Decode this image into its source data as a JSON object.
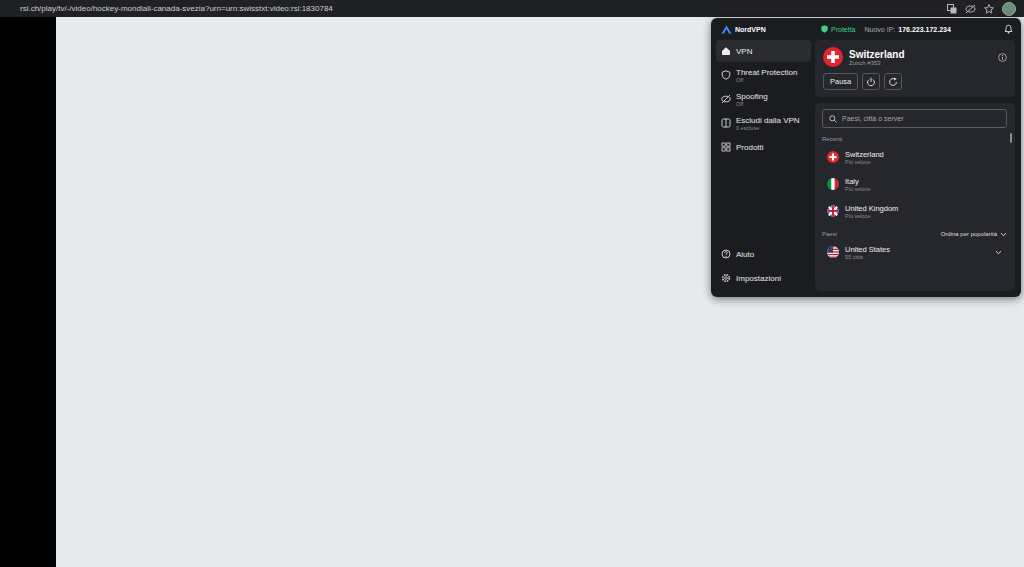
{
  "browser": {
    "url": "rsi.ch/play/tv/-/video/hockey-mondiali-canada-svezia?urn=urn:swisstxt:video:rsi:1830784"
  },
  "vpn": {
    "brand": "NordVPN",
    "status": "Protetta",
    "ip_label": "Nuovo IP:",
    "ip": "176.223.172.234",
    "nav": [
      {
        "label": "VPN",
        "sub": "",
        "kind": "home",
        "selected": true
      },
      {
        "label": "Threat Protection",
        "sub": "Off",
        "kind": "shield",
        "selected": false
      },
      {
        "label": "Spoofing",
        "sub": "Off",
        "kind": "spoof",
        "selected": false
      },
      {
        "label": "Escludi dalla VPN",
        "sub": "0 escluse",
        "kind": "split",
        "selected": false
      },
      {
        "label": "Prodotti",
        "sub": "",
        "kind": "grid",
        "selected": false
      }
    ],
    "footer_nav": [
      {
        "label": "Aiuto",
        "kind": "help"
      },
      {
        "label": "Impostazioni",
        "kind": "gear"
      }
    ],
    "current": {
      "country": "Switzerland",
      "server": "Zurich #353",
      "kind": "ch",
      "pause": "Pausa"
    },
    "search": {
      "placeholder": "Paesi, città o server"
    },
    "recent_title": "Recenti",
    "recents": [
      {
        "country": "Switzerland",
        "detail": "Più veloce",
        "kind": "ch"
      },
      {
        "country": "Italy",
        "detail": "Più veloce",
        "kind": "it"
      },
      {
        "country": "United Kingdom",
        "detail": "Più veloce",
        "kind": "gb"
      }
    ],
    "countries_title": "Paesi",
    "sort": "Ordina per popolarità",
    "countries": [
      {
        "country": "United States",
        "detail": "55 città",
        "kind": "us"
      }
    ]
  }
}
